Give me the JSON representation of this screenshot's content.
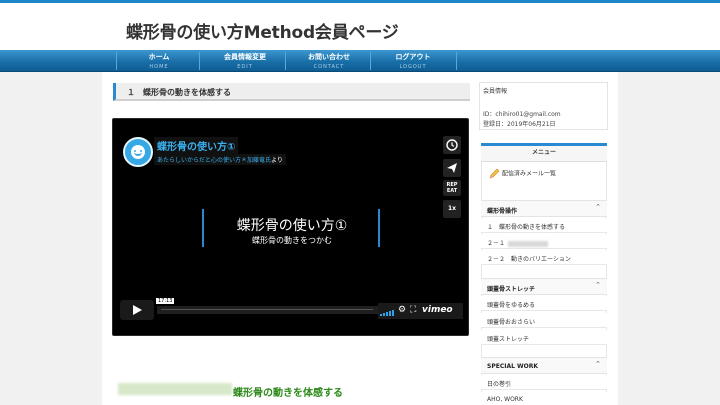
{
  "header": {
    "site_title": "蝶形骨の使い方Method会員ページ"
  },
  "nav": [
    {
      "ja": "ホーム",
      "en": "HOME"
    },
    {
      "ja": "会員情報変更",
      "en": "EDIT"
    },
    {
      "ja": "お問い合わせ",
      "en": "CONTACT"
    },
    {
      "ja": "ログアウト",
      "en": "LOGOUT"
    }
  ],
  "main": {
    "section_title": "１　蝶形骨の動きを体感する",
    "video": {
      "title": "蝶形骨の使い方①",
      "by_prefix": "あたらしいからだと心の使い方",
      "by_author": "＊加藤竜氏",
      "by_suffix": "より",
      "card_title": "蝶形骨の使い方①",
      "card_subtitle": "蝶形骨の動きをつかむ",
      "time": "17:13",
      "rep_label": "REP",
      "rep_sub": "EAT",
      "speed": "1x",
      "logo": "vimeo",
      "play_icon": "play-icon",
      "clock_icon": "clock-icon",
      "send_icon": "send-icon"
    },
    "green_heading": "蝶形骨の動きを体感する"
  },
  "sidebar": {
    "member": {
      "title": "会員情報",
      "id_line": "ID：chihiro01@gmail.com",
      "date_line": "登録日：2019年06月21日"
    },
    "menu_title": "メニュー",
    "download_link": "配信済みメール一覧",
    "categories": [
      {
        "label": "蝶形骨操作",
        "items": [
          "１　蝶形骨の動きを体感する",
          "２－１",
          "２－２　動きのバリエーション"
        ]
      },
      {
        "label": "頭蓋骨ストレッチ",
        "items": [
          "頭蓋骨をゆるめる",
          "頭蓋骨おおさらい",
          "頭蓋ストレッチ"
        ]
      },
      {
        "label": "SPECIAL WORK",
        "items": [
          "日の巻引",
          "AHO, WORK"
        ]
      }
    ]
  },
  "colors": {
    "accent": "#2a8ad0",
    "nav": "#1a6fa8",
    "green": "#2e8a1a",
    "vimeo_blue": "#3ab0ee"
  }
}
